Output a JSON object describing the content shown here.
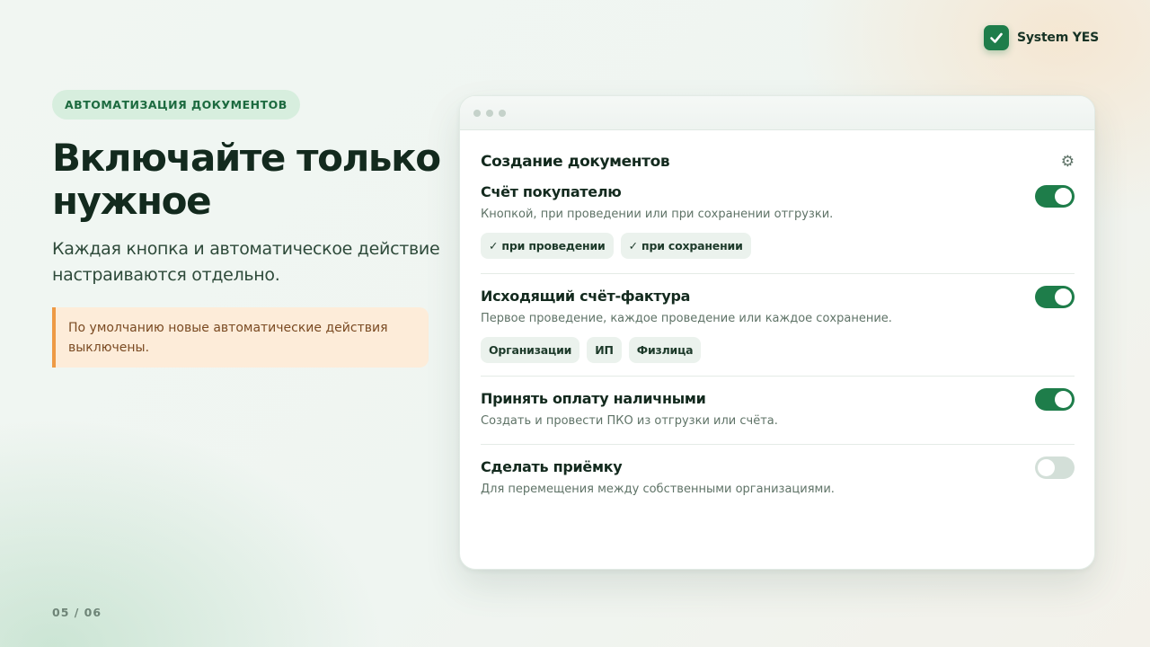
{
  "brand": {
    "name": "System YES",
    "icon": "check-square-icon",
    "accent_color": "#1e7d4a"
  },
  "slide": {
    "eyebrow": "АВТОМАТИЗАЦИЯ ДОКУМЕНТОВ",
    "title": "Включайте только нужное",
    "subtitle": "Каждая кнопка и автоматическое действие настраиваются отдельно.",
    "note": "По умолчанию новые автоматические действия выключены.",
    "page_number": "05 / 06"
  },
  "panel": {
    "title": "Создание документов",
    "settings_icon": "gear-icon",
    "items": [
      {
        "name": "Счёт покупателю",
        "description": "Кнопкой, при проведении или при сохранении отгрузки.",
        "enabled": true,
        "chips": [
          "✓ при проведении",
          "✓ при сохранении"
        ]
      },
      {
        "name": "Исходящий счёт-фактура",
        "description": "Первое проведение, каждое проведение или каждое сохранение.",
        "enabled": true,
        "chips": [
          "Организации",
          "ИП",
          "Физлица"
        ]
      },
      {
        "name": "Принять оплату наличными",
        "description": "Создать и провести ПКО из отгрузки или счёта.",
        "enabled": true,
        "chips": []
      },
      {
        "name": "Сделать приёмку",
        "description": "Для перемещения между собственными организациями.",
        "enabled": false,
        "chips": []
      }
    ]
  }
}
